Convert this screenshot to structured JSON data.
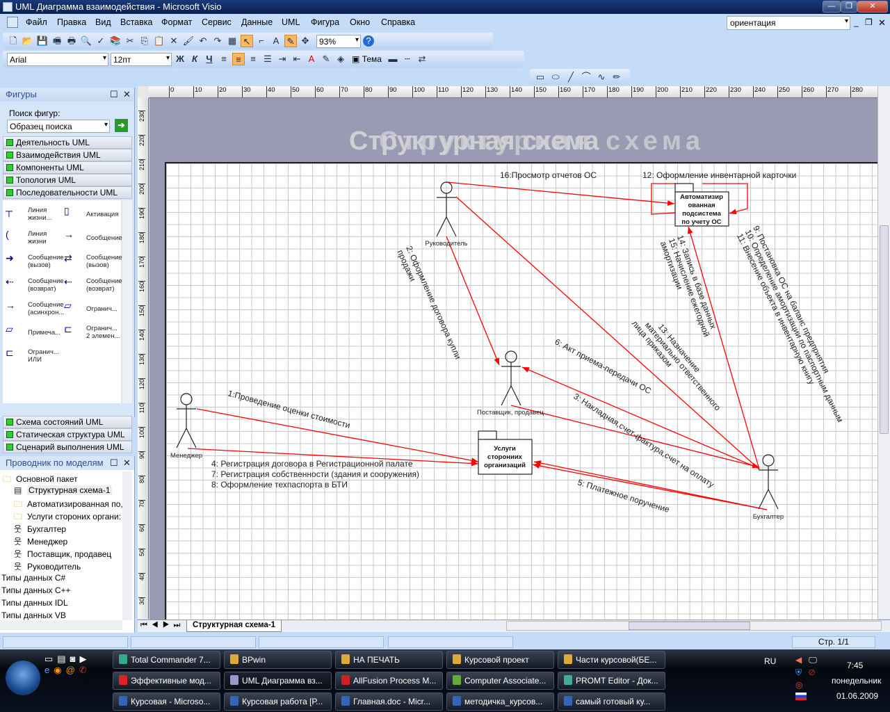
{
  "window": {
    "title": "UML Диаграмма взаимодействия - Microsoft Visio",
    "minimize": "—",
    "restore": "❐",
    "close": "✕"
  },
  "menu": [
    "Файл",
    "Правка",
    "Вид",
    "Вставка",
    "Формат",
    "Сервис",
    "Данные",
    "UML",
    "Фигура",
    "Окно",
    "Справка"
  ],
  "help_search": {
    "value": "ориентация"
  },
  "toolbar1": {
    "icons": [
      "new-icon",
      "open-icon",
      "save-icon",
      "permissions-icon",
      "print-icon",
      "print-preview-icon",
      "spelling-icon",
      "research-icon",
      "cut-icon",
      "copy-icon",
      "paste-icon",
      "delete-icon",
      "format-painter-icon",
      "undo-icon",
      "redo-icon",
      "shapes-icon",
      "pointer-tool-icon",
      "connector-tool-icon",
      "text-tool-icon",
      "connection-point-icon",
      "pan-zoom-icon"
    ],
    "zoom": "93%",
    "help_icon": "help-icon"
  },
  "toolbar2": {
    "font": "Arial",
    "size": "12пт",
    "bold": "Ж",
    "italic": "К",
    "underline": "Ч",
    "icons": [
      "align-left-icon",
      "align-center-icon",
      "align-right-icon",
      "bullets-icon",
      "indent-icon",
      "outdent-icon",
      "font-color-icon",
      "line-color-icon",
      "fill-color-icon"
    ],
    "theme": "Тема",
    "extra_icons": [
      "line-weight-icon",
      "line-pattern-icon",
      "line-ends-icon"
    ]
  },
  "drawing_toolbar": {
    "icons": [
      "rectangle-tool-icon",
      "ellipse-tool-icon",
      "line-tool-icon",
      "arc-tool-icon",
      "freeform-tool-icon",
      "pencil-tool-icon"
    ]
  },
  "shapes_panel": {
    "title": "Фигуры",
    "search_label": "Поиск фигур:",
    "search_placeholder": "Образец поиска",
    "stencils_top": [
      "Деятельность UML",
      "Взаимодействия UML",
      "Компоненты UML",
      "Топология UML",
      "Последовательности UML"
    ],
    "shapes": [
      [
        "Линия",
        "жизни..."
      ],
      [
        "Активация"
      ],
      [
        "Линия",
        "жизни"
      ],
      [
        "Сообщение"
      ],
      [
        "Сообщение",
        "(вызов)"
      ],
      [
        "Сообщение",
        "(вызов)"
      ],
      [
        "Сообщение",
        "(возврат)"
      ],
      [
        "Сообщение",
        "(возврат)"
      ],
      [
        "Сообщение",
        "(асинхрон..."
      ],
      [
        "Огранич..."
      ],
      [
        "Примеча..."
      ],
      [
        "Огранич...",
        "2 элемен..."
      ],
      [
        "Огранич...",
        "ИЛИ"
      ]
    ],
    "stencils_bottom": [
      "Схема состояний UML",
      "Статическая структура UML",
      "Сценарий выполнения UML"
    ]
  },
  "explorer": {
    "title": "Проводник по моделям",
    "items": [
      "Основной пакет",
      "Структурная схема-1",
      "Автоматизированная по,",
      "Услуги стороних органи:",
      "Бухгалтер",
      "Менеджер",
      "Поставщик, продавец",
      "Руководитель",
      "Типы данных C#",
      "Типы данных C++",
      "Типы данных IDL",
      "Типы данных VB"
    ]
  },
  "ruler": {
    "h": [
      "0",
      "10",
      "20",
      "30",
      "40",
      "50",
      "60",
      "70",
      "80",
      "90",
      "100",
      "110",
      "120",
      "130",
      "140",
      "150",
      "160",
      "170",
      "180",
      "190",
      "200",
      "210",
      "220",
      "230",
      "240",
      "250",
      "260",
      "270",
      "280"
    ],
    "v": [
      "230",
      "220",
      "210",
      "200",
      "190",
      "180",
      "170",
      "160",
      "150",
      "140",
      "130",
      "120",
      "110",
      "100",
      "90",
      "80",
      "70",
      "60",
      "50",
      "40",
      "30"
    ]
  },
  "diagram": {
    "background_title": "Структурная схема",
    "actors": {
      "head": "Руководитель",
      "supplier": "Поставщик, продавец",
      "manager": "Менеджер",
      "accountant": "Бухгалтер"
    },
    "systems": {
      "auto": [
        "Автоматизир",
        "ованная",
        "подсистема",
        "по учету ОС"
      ],
      "services": [
        "Услуги",
        "сторониих",
        "организаций"
      ]
    },
    "messages": {
      "m16": "16:Просмотр отчетов ОС",
      "m12": "12: Оформление инвентарной карточки",
      "m2": [
        "2: Оформление договора купли",
        "продажи"
      ],
      "m1": "1:Проведение оценки стоимости",
      "m478": [
        "4: Регистрация договора в Регистрационной палате",
        "7: Регистрация собственности (здания и сооружения)",
        "8: Оформление техпаспорта в БТИ"
      ],
      "m6": "6: Акт приема-передачи ОС",
      "m3": "3: Накладная,счет-фактура,счет на оплату",
      "m5": "5: Платежное поручение",
      "m13": [
        "13: Назначение",
        "материально ответственного",
        "лица приказом"
      ],
      "m1415": [
        "14: Запись в базе данных",
        "15: Начисление ежегодной",
        "амортизации"
      ],
      "m91011": [
        "9: Постановка ОС на баланс предприятия",
        "10: Определение амортизации по паспортным данным",
        "11: Внесение объекта в инвентарную книгу"
      ]
    },
    "line_color": "#ff0000"
  },
  "page_tab": "Структурная схема-1",
  "status": {
    "page": "Стр. 1/1"
  },
  "taskbar": {
    "tasks": [
      "Total Commander 7...",
      "BPwin",
      "НА ПЕЧАТЬ",
      "Курсовой проект",
      "Части курсовой(БЕ...",
      "Эффективные мод...",
      "UML Диаграмма вз...",
      "AllFusion Process M...",
      "Computer Associate...",
      "PROMT Editor - Док...",
      "Курсовая - Microso...",
      "Курсовая работа [Р...",
      "Главная.doc - Micr...",
      "методичка_курсов...",
      "самый готовый ку..."
    ],
    "lang": "RU",
    "time": "7:45",
    "day": "понедельник",
    "date": "01.06.2009"
  }
}
